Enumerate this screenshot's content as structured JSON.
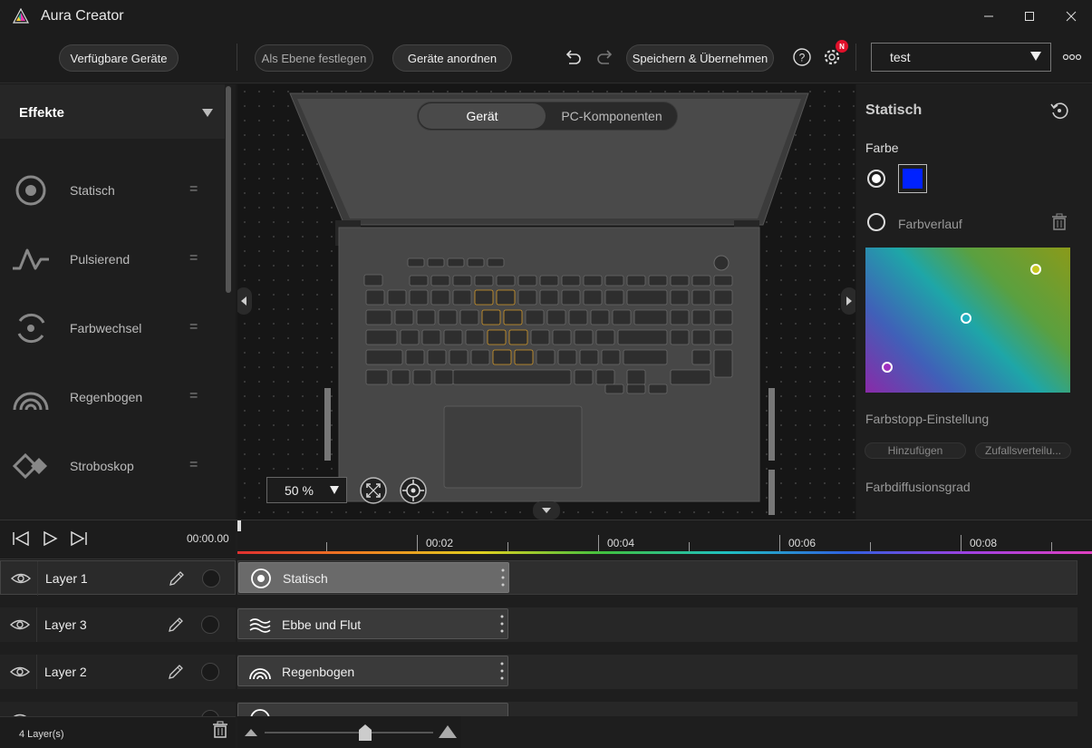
{
  "app": {
    "title": "Aura Creator"
  },
  "toolbar": {
    "available_devices": "Verfügbare Geräte",
    "set_as_layer": "Als Ebene festlegen",
    "arrange_devices": "Geräte anordnen",
    "save_apply": "Speichern & Übernehmen",
    "notification_badge": "N",
    "profile_value": "test",
    "undo_icon": "undo-icon",
    "redo_icon": "redo-icon",
    "help_icon": "help-icon",
    "settings_icon": "gear-icon",
    "more_icon": "more-icon"
  },
  "effects": {
    "header": "Effekte",
    "items": [
      {
        "label": "Statisch",
        "icon": "static-icon"
      },
      {
        "label": "Pulsierend",
        "icon": "pulse-icon"
      },
      {
        "label": "Farbwechsel",
        "icon": "color-cycle-icon"
      },
      {
        "label": "Regenbogen",
        "icon": "rainbow-icon"
      },
      {
        "label": "Stroboskop",
        "icon": "strobe-icon"
      }
    ]
  },
  "canvas": {
    "tab_device": "Gerät",
    "tab_pc_components": "PC-Komponenten",
    "zoom": "50 %"
  },
  "right_panel": {
    "title": "Statisch",
    "color_label": "Farbe",
    "gradient_label": "Farbverlauf",
    "stop_settings": "Farbstopp-Einstellung",
    "add": "Hinzufügen",
    "random": "Zufallsverteilu...",
    "diffusion": "Farbdiffusionsgrad",
    "swatch_color": "#0022ff"
  },
  "timeline": {
    "time": "00:00.00",
    "ticks": [
      "00:02",
      "00:04",
      "00:06",
      "00:08"
    ],
    "layers": [
      {
        "name": "Layer 1",
        "clip": "Statisch"
      },
      {
        "name": "Layer 3",
        "clip": "Ebbe und Flut"
      },
      {
        "name": "Layer 2",
        "clip": "Regenbogen"
      }
    ],
    "layer_count": "4 Layer(s)"
  }
}
